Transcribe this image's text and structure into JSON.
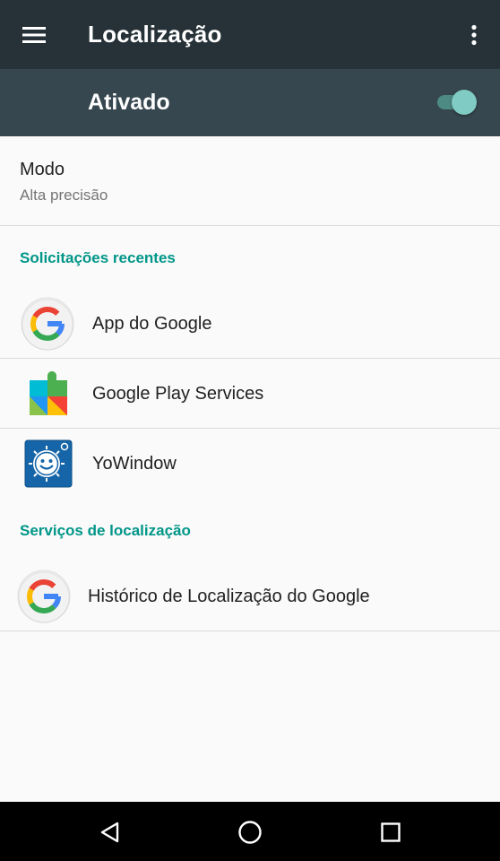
{
  "appbar": {
    "title": "Localização"
  },
  "master_switch": {
    "label": "Ativado",
    "state": "on",
    "track_color": "#4e8a84",
    "thumb_color": "#80cbc4"
  },
  "mode": {
    "title": "Modo",
    "value": "Alta precisão"
  },
  "recent_requests": {
    "header": "Solicitações recentes",
    "items": [
      {
        "label": "App do Google",
        "icon": "google-g-icon"
      },
      {
        "label": "Google Play Services",
        "icon": "play-services-icon"
      },
      {
        "label": "YoWindow",
        "icon": "yowindow-icon"
      }
    ]
  },
  "location_services": {
    "header": "Serviços de localização",
    "items": [
      {
        "label": "Histórico de Localização do Google",
        "icon": "google-g-icon"
      }
    ]
  },
  "colors": {
    "appbar": "#263238",
    "master_bar": "#37474f",
    "accent": "#009688",
    "background": "#fafafa"
  },
  "navbar": {
    "buttons": [
      "back-icon",
      "home-icon",
      "recents-icon"
    ]
  }
}
